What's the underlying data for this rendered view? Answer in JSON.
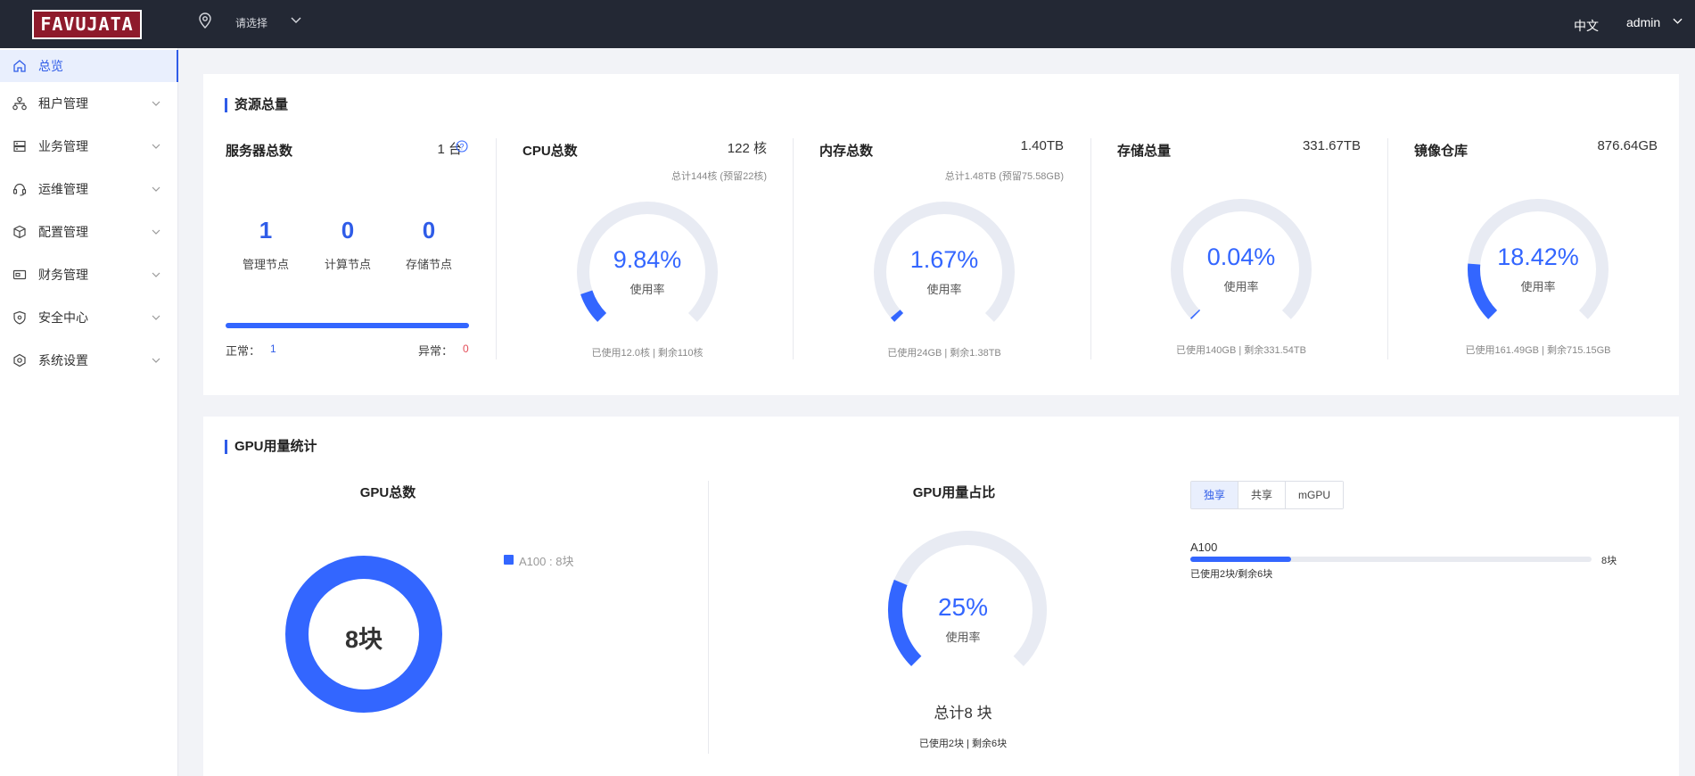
{
  "header": {
    "logo_text": "FAVUJATA",
    "location_placeholder": "请选择",
    "language": "中文",
    "user": "admin"
  },
  "sidebar": {
    "items": [
      {
        "label": "总览",
        "icon": "home-icon"
      },
      {
        "label": "租户管理",
        "icon": "org-chart-icon"
      },
      {
        "label": "业务管理",
        "icon": "server-icon"
      },
      {
        "label": "运维管理",
        "icon": "headset-icon"
      },
      {
        "label": "配置管理",
        "icon": "cube-icon"
      },
      {
        "label": "财务管理",
        "icon": "wallet-icon"
      },
      {
        "label": "安全中心",
        "icon": "shield-icon"
      },
      {
        "label": "系统设置",
        "icon": "hexagon-gear-icon"
      }
    ]
  },
  "resources": {
    "section_title": "资源总量",
    "servers": {
      "title": "服务器总数",
      "value": "1 台",
      "nodes": [
        {
          "count": "1",
          "label": "管理节点"
        },
        {
          "count": "0",
          "label": "计算节点"
        },
        {
          "count": "0",
          "label": "存储节点"
        }
      ],
      "normal_label": "正常：",
      "normal_value": "1",
      "abnormal_label": "异常：",
      "abnormal_value": "0",
      "normal_fraction": 1.0
    },
    "cards": [
      {
        "title": "CPU总数",
        "value": "122 核",
        "sub": "总计144核 (预留22核)",
        "percent_text": "9.84%",
        "percent": 9.84,
        "usage_label": "使用率",
        "foot": "已使用12.0核 | 剩余110核"
      },
      {
        "title": "内存总数",
        "value": "1.40TB",
        "sub": "总计1.48TB (预留75.58GB)",
        "percent_text": "1.67%",
        "percent": 1.67,
        "usage_label": "使用率",
        "foot": "已使用24GB | 剩余1.38TB"
      },
      {
        "title": "存储总量",
        "value": "331.67TB",
        "sub": "",
        "percent_text": "0.04%",
        "percent": 0.04,
        "usage_label": "使用率",
        "foot": "已使用140GB | 剩余331.54TB"
      },
      {
        "title": "镜像仓库",
        "value": "876.64GB",
        "sub": "",
        "percent_text": "18.42%",
        "percent": 18.42,
        "usage_label": "使用率",
        "foot": "已使用161.49GB | 剩余715.15GB"
      }
    ]
  },
  "gpu": {
    "section_title": "GPU用量统计",
    "total": {
      "title": "GPU总数",
      "center": "8块",
      "legend": [
        {
          "name": "A100",
          "text": "8块",
          "color": "#3366ff"
        }
      ]
    },
    "usage": {
      "title": "GPU用量占比",
      "percent_text": "25%",
      "percent": 25,
      "usage_label": "使用率",
      "total_text": "总计8 块",
      "foot": "已使用2块 | 剩余6块"
    },
    "tabs": [
      "独享",
      "共享",
      "mGPU"
    ],
    "active_tab": 0,
    "models": [
      {
        "name": "A100",
        "total_text": "8块",
        "used_fraction": 0.25,
        "detail": "已使用2块/剩余6块"
      }
    ]
  },
  "colors": {
    "accent": "#3366ff",
    "track": "#e8ebf3",
    "danger": "#e34d59",
    "topbar": "#232834"
  }
}
